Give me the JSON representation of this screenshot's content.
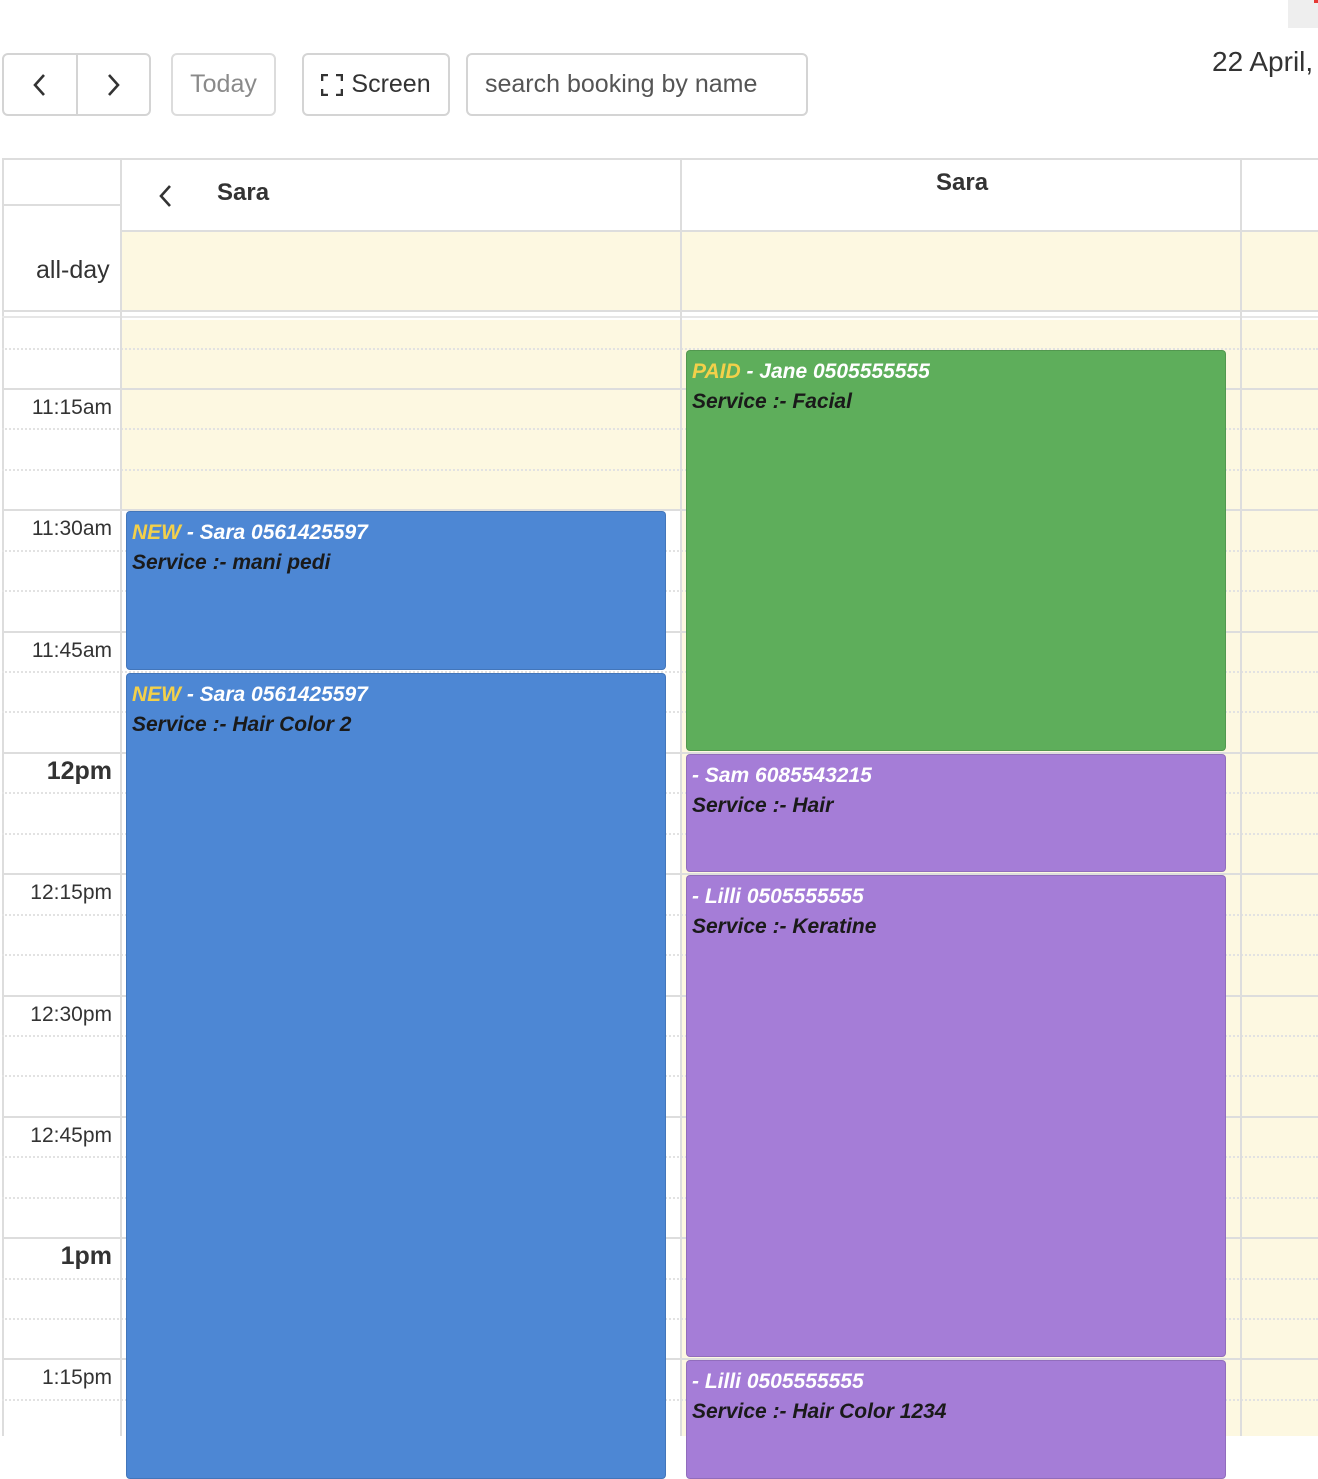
{
  "toolbar": {
    "prev_icon": "chevron-left-icon",
    "next_icon": "chevron-right-icon",
    "today_label": "Today",
    "screen_label": "Screen",
    "screen_icon": "fullscreen-icon",
    "search_placeholder": "search booking by name",
    "date_title": "22 April,"
  },
  "calendar": {
    "resources": [
      {
        "name": "Sara",
        "has_back_arrow": true
      },
      {
        "name": "Sara",
        "has_back_arrow": false
      }
    ],
    "allday_label": "all-day",
    "time_labels": [
      {
        "label": "11:15am",
        "hour": false
      },
      {
        "label": "11:30am",
        "hour": false
      },
      {
        "label": "11:45am",
        "hour": false
      },
      {
        "label": "12pm",
        "hour": true
      },
      {
        "label": "12:15pm",
        "hour": false
      },
      {
        "label": "12:30pm",
        "hour": false
      },
      {
        "label": "12:45pm",
        "hour": false
      },
      {
        "label": "1pm",
        "hour": true
      },
      {
        "label": "1:15pm",
        "hour": false
      }
    ],
    "events": [
      {
        "resource": 0,
        "status": "NEW",
        "name": " - Sara 0561425597",
        "service": "Service :- mani pedi",
        "color": "#4d87d4",
        "start": "11:30",
        "end": "11:50"
      },
      {
        "resource": 0,
        "status": "NEW",
        "name": " - Sara 0561425597",
        "service": "Service :- Hair Color 2",
        "color": "#4d87d4",
        "start": "11:50",
        "end": "13:30"
      },
      {
        "resource": 1,
        "status": "PAID",
        "name": " - Jane 0505555555",
        "service": "Service :- Facial",
        "color": "#5eae5b",
        "start": "11:10",
        "end": "12:00"
      },
      {
        "resource": 1,
        "status": "",
        "name": "- Sam 6085543215",
        "service": "Service :- Hair",
        "color": "#a57dd7",
        "start": "12:00",
        "end": "12:15"
      },
      {
        "resource": 1,
        "status": "",
        "name": "- Lilli 0505555555",
        "service": "Service :- Keratine",
        "color": "#a57dd7",
        "start": "12:15",
        "end": "13:15"
      },
      {
        "resource": 1,
        "status": "",
        "name": "- Lilli 0505555555",
        "service": "Service :- Hair Color 1234",
        "color": "#a57dd7",
        "start": "13:15",
        "end": "13:30"
      }
    ]
  }
}
